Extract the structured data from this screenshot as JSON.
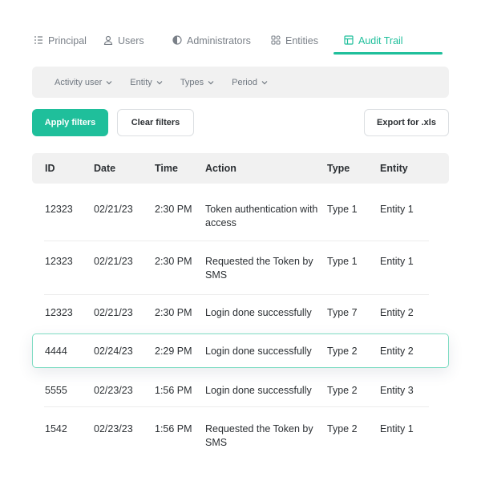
{
  "tabs": [
    {
      "label": "Principal",
      "icon": "list-icon",
      "active": false
    },
    {
      "label": "Users",
      "icon": "user-icon",
      "active": false
    },
    {
      "label": "Administrators",
      "icon": "shield-icon",
      "active": false
    },
    {
      "label": "Entities",
      "icon": "grid-icon",
      "active": false
    },
    {
      "label": "Audit Trail",
      "icon": "table-icon",
      "active": true
    }
  ],
  "filters": [
    {
      "label": "Activity user"
    },
    {
      "label": "Entity"
    },
    {
      "label": "Types"
    },
    {
      "label": "Period"
    }
  ],
  "actions": {
    "apply_label": "Apply filters",
    "clear_label": "Clear filters",
    "export_label": "Export for .xls"
  },
  "colors": {
    "accent": "#1fbf9b",
    "highlight_border": "#7fdcc3"
  },
  "table": {
    "columns": [
      "ID",
      "Date",
      "Time",
      "Action",
      "Type",
      "Entity"
    ],
    "rows": [
      {
        "id": "12323",
        "date": "02/21/23",
        "time": "2:30 PM",
        "action": "Token authentication with access",
        "type": "Type 1",
        "entity": "Entity 1",
        "highlighted": false
      },
      {
        "id": "12323",
        "date": "02/21/23",
        "time": "2:30 PM",
        "action": "Requested the Token by SMS",
        "type": "Type 1",
        "entity": "Entity 1",
        "highlighted": false
      },
      {
        "id": "12323",
        "date": "02/21/23",
        "time": "2:30 PM",
        "action": "Login done successfully",
        "type": "Type 7",
        "entity": "Entity 2",
        "highlighted": false
      },
      {
        "id": "4444",
        "date": "02/24/23",
        "time": "2:29 PM",
        "action": "Login done successfully",
        "type": "Type 2",
        "entity": "Entity 2",
        "highlighted": true
      },
      {
        "id": "5555",
        "date": "02/23/23",
        "time": "1:56 PM",
        "action": "Login done successfully",
        "type": "Type 2",
        "entity": "Entity 3",
        "highlighted": false
      },
      {
        "id": "1542",
        "date": "02/23/23",
        "time": "1:56 PM",
        "action": "Requested the Token by SMS",
        "type": "Type 2",
        "entity": "Entity 1",
        "highlighted": false
      }
    ]
  }
}
